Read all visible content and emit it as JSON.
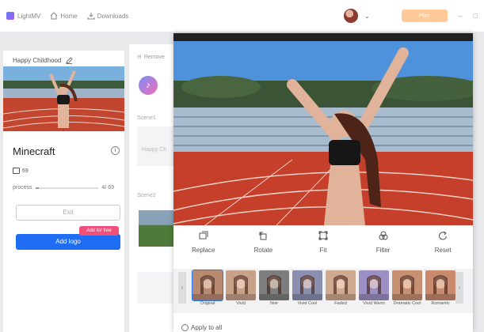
{
  "topbar": {
    "brand": "LightMV",
    "home": "Home",
    "downloads": "Downloads",
    "plan": "Plan",
    "min": "–",
    "restore": "□"
  },
  "project": {
    "title": "Happy Childhood",
    "name": "Minecraft",
    "image_count": "69",
    "progress_label": "process",
    "progress_text": "4/ 69",
    "progress_fraction": 0.06,
    "exit_label": "Exit",
    "add_logo_label": "Add logo",
    "free_badge": "Add for free"
  },
  "middle": {
    "remove_label": "Remove",
    "scene1": "Scene1",
    "scene1_text": "Happy Ch",
    "scene2": "Scene2"
  },
  "tools": [
    {
      "label": "Replace",
      "icon": "replace-icon"
    },
    {
      "label": "Rotate",
      "icon": "rotate-icon"
    },
    {
      "label": "Fit",
      "icon": "fit-icon"
    },
    {
      "label": "Filter",
      "icon": "filter-icon"
    },
    {
      "label": "Reset",
      "icon": "reset-icon"
    }
  ],
  "filters": [
    {
      "label": "Original",
      "tint": "#b98a72"
    },
    {
      "label": "Vivid",
      "tint": "#c9a08a"
    },
    {
      "label": "Noir",
      "tint": "#7d7d7d"
    },
    {
      "label": "Vivid Cool",
      "tint": "#8a8fb0"
    },
    {
      "label": "Faded",
      "tint": "#d1a890"
    },
    {
      "label": "Vivid Warm",
      "tint": "#9b8fc4"
    },
    {
      "label": "Dramatic Cool",
      "tint": "#c79070"
    },
    {
      "label": "Romantic",
      "tint": "#c98a6e"
    }
  ],
  "apply_all": "Apply to all",
  "colors": {
    "accent": "#1f6df2",
    "badge": "#f04f7a",
    "plan": "#ffc99a"
  }
}
